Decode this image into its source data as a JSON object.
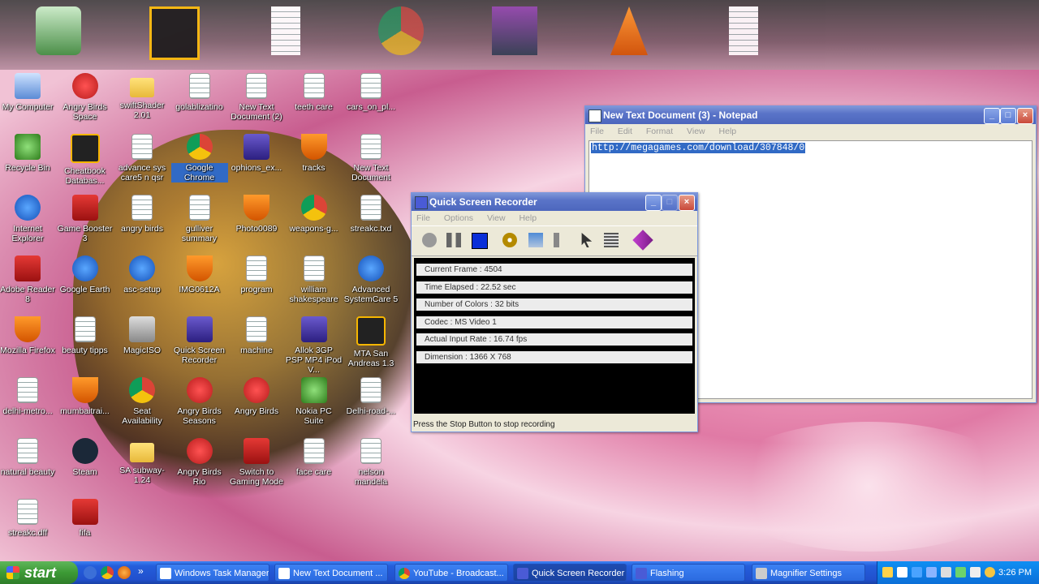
{
  "top_icons": [
    {
      "name": "recycle-bin-icon"
    },
    {
      "name": "cheatbook-icon"
    },
    {
      "name": "text-document-icon"
    },
    {
      "name": "chrome-loading-icon"
    },
    {
      "name": "winrar-icon"
    },
    {
      "name": "vlc-icon"
    },
    {
      "name": "text-document-icon"
    }
  ],
  "desktop": {
    "icons": [
      {
        "label": "My Computer",
        "icon": "pc"
      },
      {
        "label": "Angry Birds Space",
        "icon": "bird"
      },
      {
        "label": "swiftShader 2.01",
        "icon": "folder"
      },
      {
        "label": "golablizatino",
        "icon": "doc"
      },
      {
        "label": "New Text Document (2)",
        "icon": "doc"
      },
      {
        "label": "teeth care",
        "icon": "doc"
      },
      {
        "label": "cars_on_pl...",
        "icon": "doc"
      },
      {
        "label": "Recycle Bin",
        "icon": "green"
      },
      {
        "label": "Cheatbook Databas...",
        "icon": "black"
      },
      {
        "label": "advance sys care5 n qsr",
        "icon": "doc"
      },
      {
        "label": "Google Chrome",
        "icon": "chrome"
      },
      {
        "label": "ophions_ex...",
        "icon": "purple"
      },
      {
        "label": "tracks",
        "icon": "orange"
      },
      {
        "label": "New Text Document",
        "icon": "doc"
      },
      {
        "label": "Internet Explorer",
        "icon": "blue"
      },
      {
        "label": "Game Booster 3",
        "icon": "red"
      },
      {
        "label": "angry birds",
        "icon": "doc"
      },
      {
        "label": "gulliver summary",
        "icon": "doc"
      },
      {
        "label": "Photo0089",
        "icon": "orange"
      },
      {
        "label": "weapons-g...",
        "icon": "chrome"
      },
      {
        "label": "streakc.txd",
        "icon": "doc"
      },
      {
        "label": "Adobe Reader 8",
        "icon": "red"
      },
      {
        "label": "Google Earth",
        "icon": "blue"
      },
      {
        "label": "asc-setup",
        "icon": "blue"
      },
      {
        "label": "IMG0612A",
        "icon": "orange"
      },
      {
        "label": "program",
        "icon": "doc"
      },
      {
        "label": "william shakespeare",
        "icon": "doc"
      },
      {
        "label": "Advanced SystemCare 5",
        "icon": "blue"
      },
      {
        "label": "Mozilla Firefox",
        "icon": "orange"
      },
      {
        "label": "beauty tipps",
        "icon": "doc"
      },
      {
        "label": "MagicISO",
        "icon": "gray"
      },
      {
        "label": "Quick Screen Recorder",
        "icon": "purple"
      },
      {
        "label": "machine",
        "icon": "doc"
      },
      {
        "label": "Allok 3GP PSP MP4 iPod V...",
        "icon": "purple"
      },
      {
        "label": "MTA San Andreas 1.3",
        "icon": "black"
      },
      {
        "label": "delhi-metro...",
        "icon": "doc"
      },
      {
        "label": "mumbaitrai...",
        "icon": "orange"
      },
      {
        "label": "Seat Availability",
        "icon": "chrome"
      },
      {
        "label": "Angry Birds Seasons",
        "icon": "bird"
      },
      {
        "label": "Angry Birds",
        "icon": "bird"
      },
      {
        "label": "Nokia PC Suite",
        "icon": "green"
      },
      {
        "label": "Delhi-road-...",
        "icon": "doc"
      },
      {
        "label": "natural beauty",
        "icon": "doc"
      },
      {
        "label": "Steam",
        "icon": "steam"
      },
      {
        "label": "SA subway-1.24",
        "icon": "folder"
      },
      {
        "label": "Angry Birds Rio",
        "icon": "bird"
      },
      {
        "label": "Switch to Gaming Mode",
        "icon": "red"
      },
      {
        "label": "face care",
        "icon": "doc"
      },
      {
        "label": "nelson mandela",
        "icon": "doc"
      },
      {
        "label": "streakc.dff",
        "icon": "doc"
      },
      {
        "label": "fifa",
        "icon": "red"
      }
    ]
  },
  "notepad": {
    "title": "New Text Document (3) - Notepad",
    "menu": [
      "File",
      "Edit",
      "Format",
      "View",
      "Help"
    ],
    "content": "http://megagames.com/download/307848/0"
  },
  "recorder": {
    "title": "Quick Screen Recorder",
    "menu": [
      "File",
      "Options",
      "View",
      "Help"
    ],
    "status_rows": [
      "Current Frame : 4504",
      "Time Elapsed  : 22.52 sec",
      "Number of Colors  : 32 bits",
      "Codec  : MS Video 1",
      "Actual Input Rate  : 16.74 fps",
      "Dimension  : 1366 X 768"
    ],
    "footer": "Press the Stop Button to stop recording"
  },
  "taskbar": {
    "start_label": "start",
    "tasks": [
      {
        "label": "Windows Task Manager"
      },
      {
        "label": "New Text Document ..."
      },
      {
        "label": "YouTube - Broadcast..."
      },
      {
        "label": "Quick Screen Recorder"
      },
      {
        "label": "Flashing"
      },
      {
        "label": "Magnifier Settings"
      }
    ],
    "clock": "3:26 PM"
  },
  "colors": {
    "accent": "#316ac5",
    "taskbar": "#245edb",
    "start": "#3c9a35"
  }
}
